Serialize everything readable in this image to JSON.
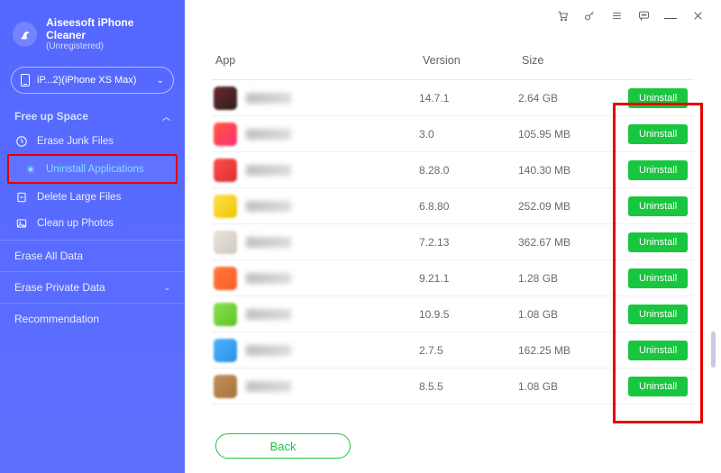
{
  "brand": {
    "title": "Aiseesoft iPhone Cleaner",
    "subtitle": "(Unregistered)"
  },
  "device": {
    "label": "iP...2)(iPhone XS Max)"
  },
  "nav": {
    "free_up_space": "Free up Space",
    "erase_junk": "Erase Junk Files",
    "uninstall_apps": "Uninstall Applications",
    "delete_large": "Delete Large Files",
    "clean_photos": "Clean up Photos",
    "erase_all": "Erase All Data",
    "erase_private": "Erase Private Data",
    "recommendation": "Recommendation"
  },
  "headers": {
    "app": "App",
    "version": "Version",
    "size": "Size"
  },
  "uninstall_label": "Uninstall",
  "back_label": "Back",
  "apps": [
    {
      "version": "14.7.1",
      "size": "2.64 GB"
    },
    {
      "version": "3.0",
      "size": "105.95 MB"
    },
    {
      "version": "8.28.0",
      "size": "140.30 MB"
    },
    {
      "version": "6.8.80",
      "size": "252.09 MB"
    },
    {
      "version": "7.2.13",
      "size": "362.67 MB"
    },
    {
      "version": "9.21.1",
      "size": "1.28 GB"
    },
    {
      "version": "10.9.5",
      "size": "1.08 GB"
    },
    {
      "version": "2.7.5",
      "size": "162.25 MB"
    },
    {
      "version": "8.5.5",
      "size": "1.08 GB"
    }
  ]
}
